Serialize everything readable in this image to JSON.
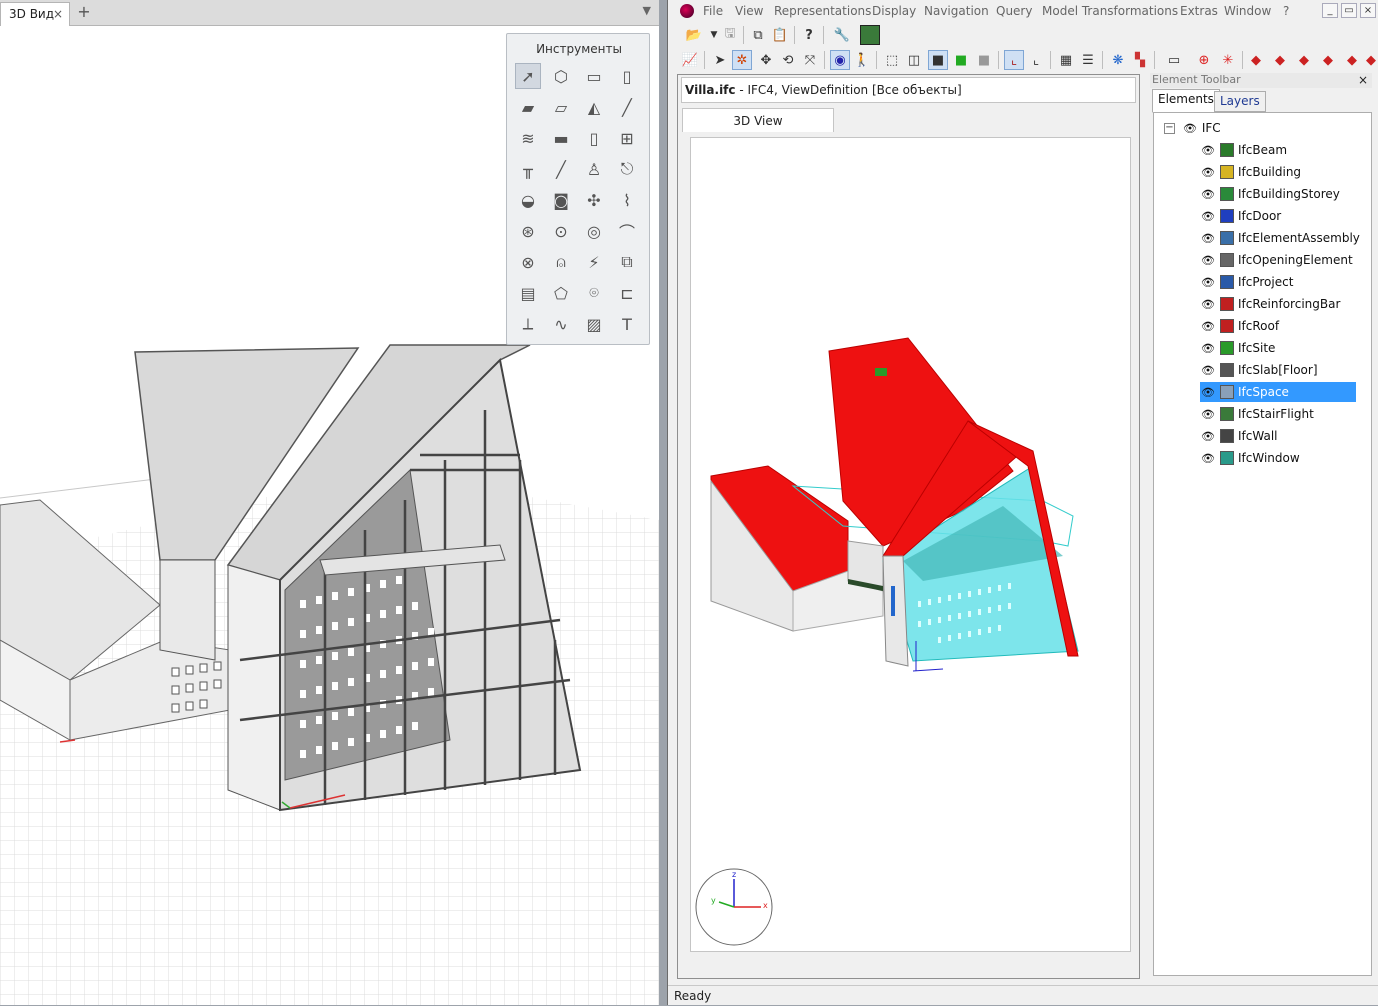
{
  "left_app": {
    "tab_label": "3D Вид",
    "tab_close": "×",
    "add_tab": "+",
    "tab_menu": "▼",
    "tools_panel": {
      "title": "Инструменты",
      "icons": [
        "select-arrow-icon",
        "object-icon",
        "frame-icon",
        "column-icon",
        "wall-icon",
        "slab-icon",
        "roof-icon",
        "beam-icon",
        "stair-icon",
        "floor-icon",
        "door-icon",
        "window-icon",
        "railing-icon",
        "line-icon",
        "toilet-icon",
        "pipe-icon",
        "sink-icon",
        "washer-icon",
        "fan-icon",
        "duct-icon",
        "valve-icon",
        "heater-icon",
        "pump-icon",
        "fitting-icon",
        "hvac-icon",
        "lamp-icon",
        "electric-icon",
        "copy-icon",
        "panel-icon",
        "shape-icon",
        "camera-icon",
        "bracket-icon",
        "dimension-icon",
        "spline-icon",
        "hatch-icon",
        "text-icon"
      ]
    }
  },
  "right_app": {
    "menu": [
      "File",
      "View",
      "Representations",
      "Display",
      "Navigation",
      "Query",
      "Model Transformations",
      "Extras",
      "Window",
      "?"
    ],
    "window_buttons": [
      "_",
      "▭",
      "×"
    ],
    "document": {
      "file": "Villa.ifc",
      "rest": " - IFC4, ViewDefinition [Все объекты]",
      "tab": "3D View"
    },
    "axis_labels": {
      "z": "z",
      "y": "y",
      "x": "x"
    },
    "element_toolbar": {
      "title": "Element Toolbar",
      "close": "×",
      "tabs": [
        "Elements",
        "Layers"
      ],
      "root": "IFC",
      "expander": "−",
      "items": [
        {
          "label": "IfcBeam",
          "icon": "beam-icon",
          "color": "#2a7a2a"
        },
        {
          "label": "IfcBuilding",
          "icon": "building-icon",
          "color": "#d6b422"
        },
        {
          "label": "IfcBuildingStorey",
          "icon": "storey-icon",
          "color": "#2a8a3a"
        },
        {
          "label": "IfcDoor",
          "icon": "door-icon",
          "color": "#1f3fbf"
        },
        {
          "label": "IfcElementAssembly",
          "icon": "assembly-icon",
          "color": "#3a6fa8"
        },
        {
          "label": "IfcOpeningElement",
          "icon": "opening-icon",
          "color": "#666666"
        },
        {
          "label": "IfcProject",
          "icon": "project-icon",
          "color": "#2a5aa8"
        },
        {
          "label": "IfcReinforcingBar",
          "icon": "question-icon",
          "color": "#c02020"
        },
        {
          "label": "IfcRoof",
          "icon": "roof-icon",
          "color": "#c02020"
        },
        {
          "label": "IfcSite",
          "icon": "site-icon",
          "color": "#2a9a2a"
        },
        {
          "label": "IfcSlab[Floor]",
          "icon": "slab-icon",
          "color": "#555555"
        },
        {
          "label": "IfcSpace",
          "icon": "space-icon",
          "color": "#8aa0b8",
          "selected": true
        },
        {
          "label": "IfcStairFlight",
          "icon": "stair-icon",
          "color": "#3a7a3a"
        },
        {
          "label": "IfcWall",
          "icon": "wall-icon",
          "color": "#444444"
        },
        {
          "label": "IfcWindow",
          "icon": "window-icon",
          "color": "#2a9a8a"
        }
      ]
    },
    "status": "Ready"
  },
  "colors": {
    "roof_red": "#ee1111",
    "space_cyan": "#66e0e8",
    "selection_blue": "#3399ff"
  }
}
